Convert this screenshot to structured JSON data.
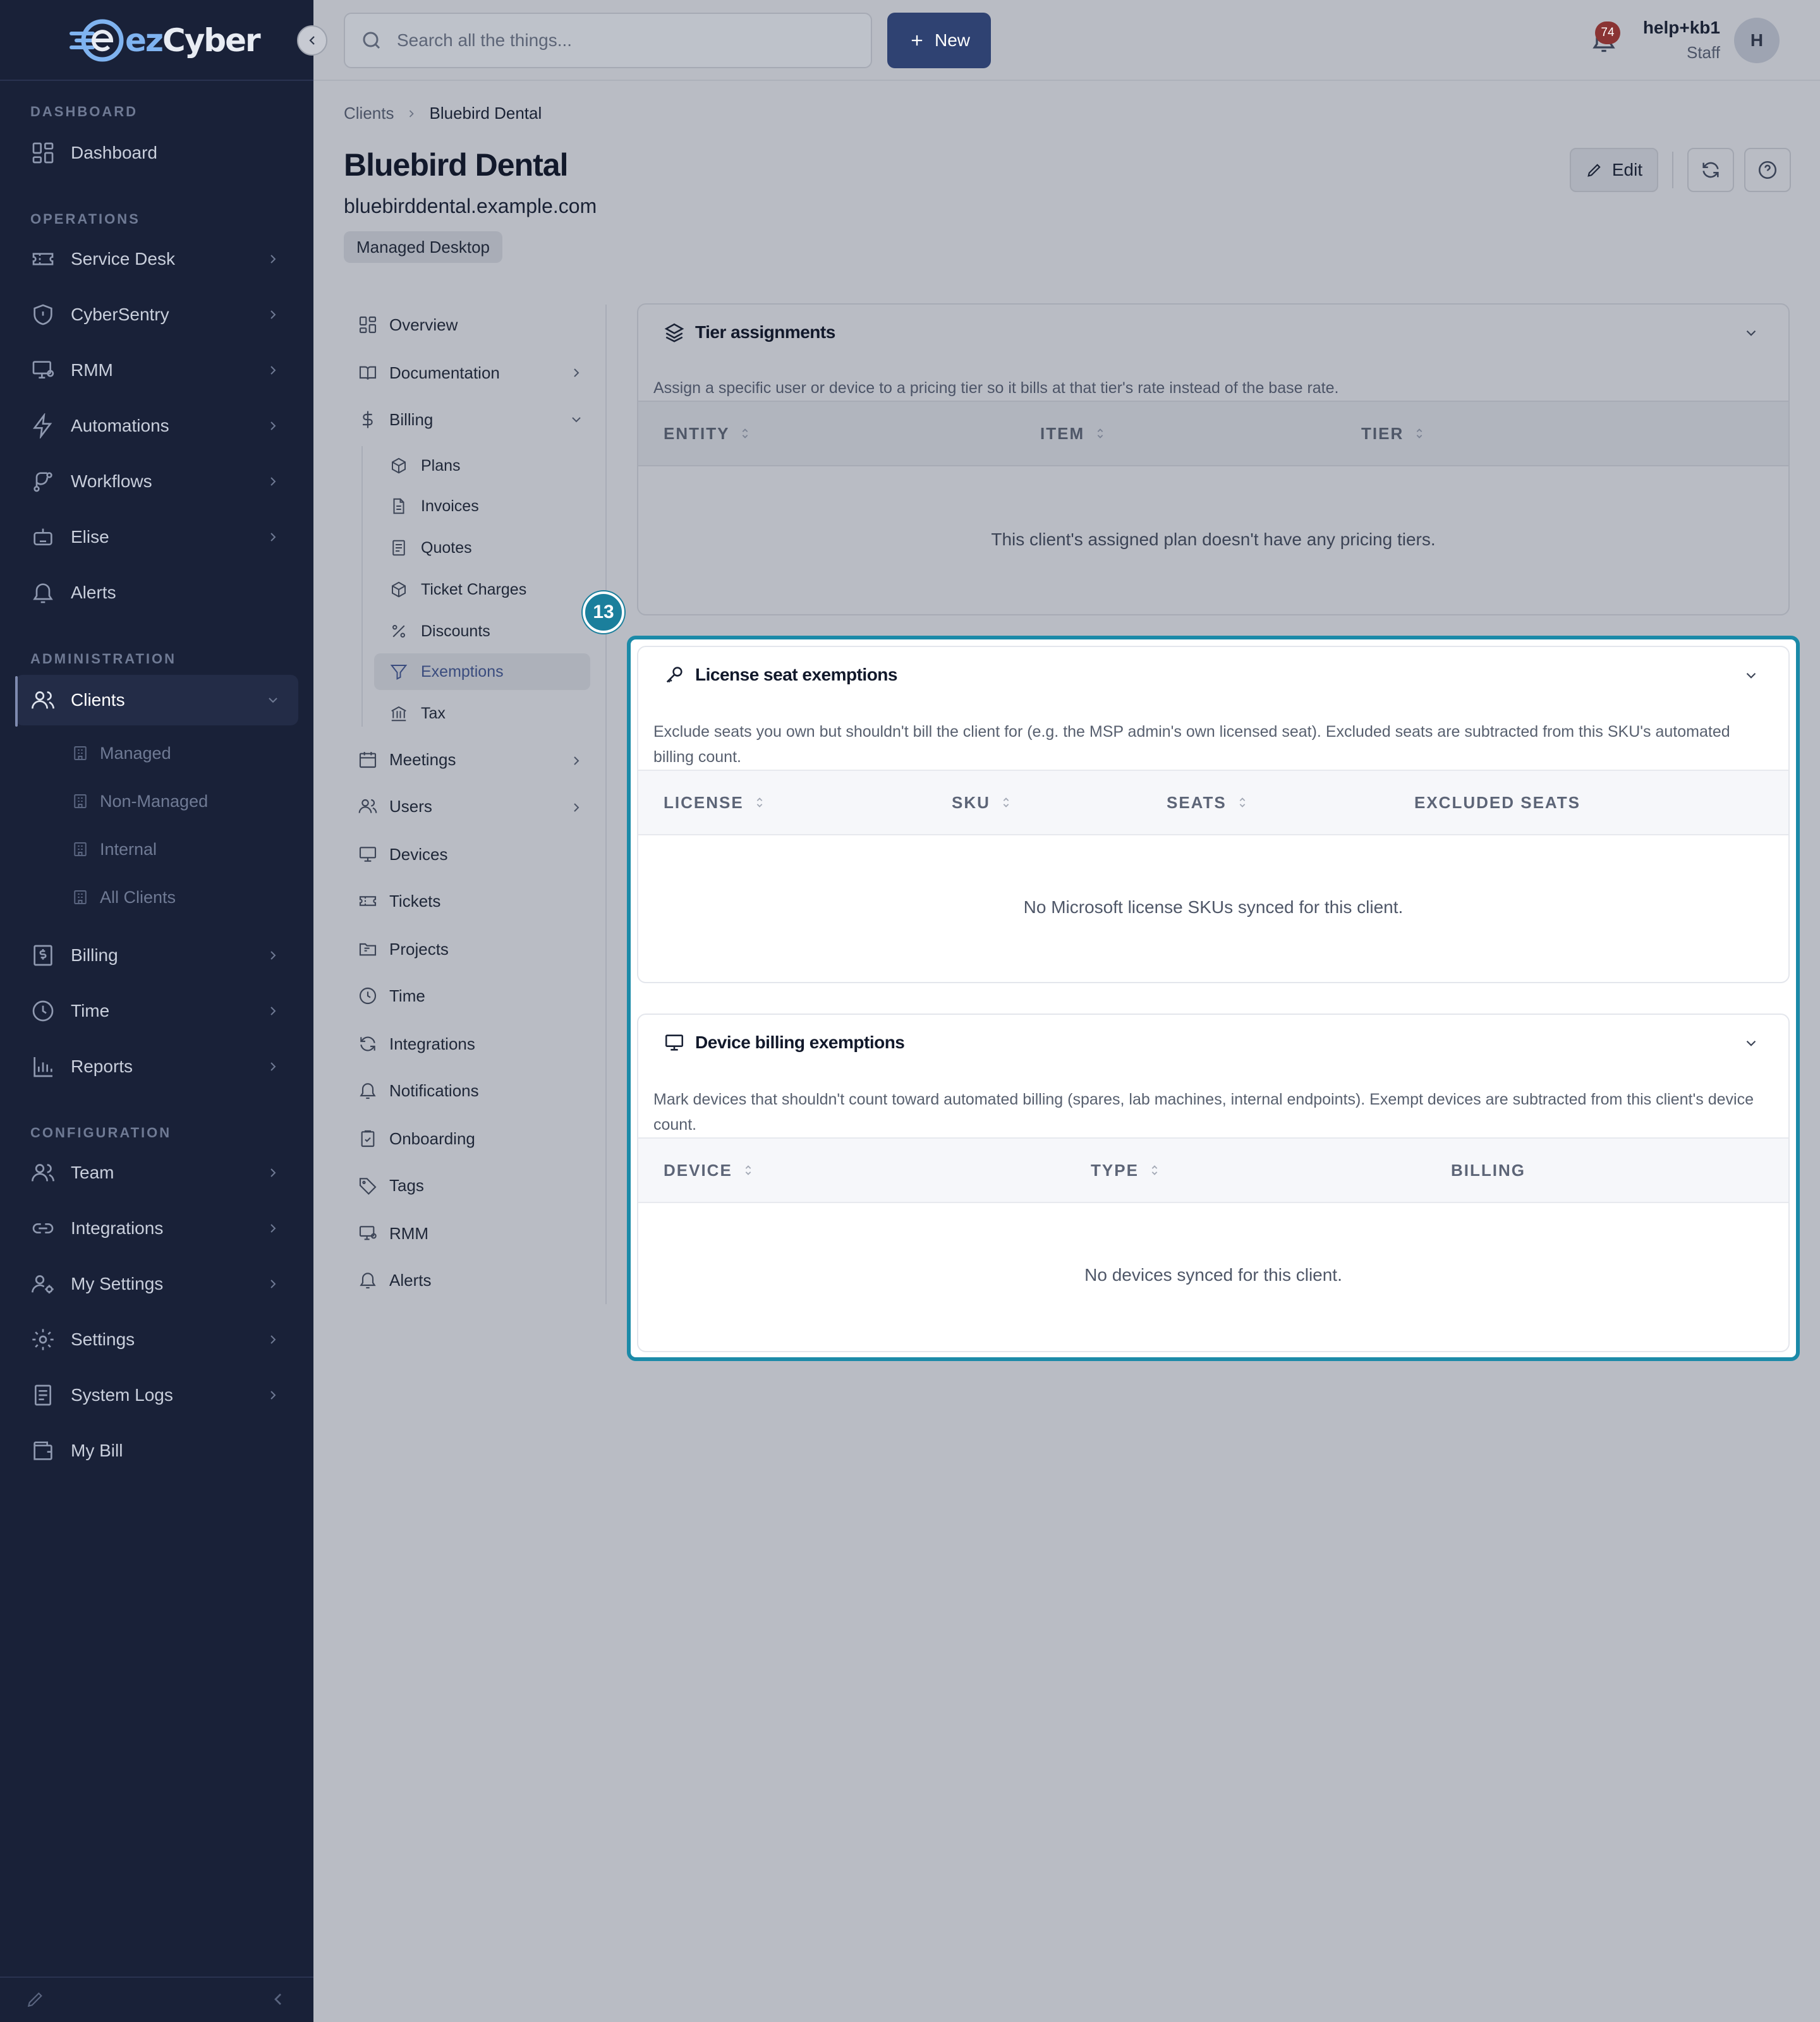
{
  "app": {
    "name": "ezCyber",
    "name_prefix": "ez",
    "name_suffix": "Cyber"
  },
  "sidebar": {
    "sections": {
      "dashboard": "DASHBOARD",
      "operations": "OPERATIONS",
      "administration": "ADMINISTRATION",
      "configuration": "CONFIGURATION"
    },
    "items": {
      "dashboard": "Dashboard",
      "service_desk": "Service Desk",
      "cybersentry": "CyberSentry",
      "rmm": "RMM",
      "automations": "Automations",
      "workflows": "Workflows",
      "elise": "Elise",
      "alerts": "Alerts",
      "clients": "Clients",
      "billing": "Billing",
      "time": "Time",
      "reports": "Reports",
      "team": "Team",
      "integrations": "Integrations",
      "my_settings": "My Settings",
      "settings": "Settings",
      "system_logs": "System Logs",
      "my_bill": "My Bill"
    },
    "clients_sub": {
      "managed": "Managed",
      "non_managed": "Non-Managed",
      "internal": "Internal",
      "all_clients": "All Clients"
    }
  },
  "topbar": {
    "search_placeholder": "Search all the things...",
    "new_label": "New",
    "notification_count": "74",
    "user_name": "help+kb1",
    "user_role": "Staff",
    "avatar_initial": "H"
  },
  "page": {
    "breadcrumb_root": "Clients",
    "breadcrumb_current": "Bluebird Dental",
    "title": "Bluebird Dental",
    "domain": "bluebirddental.example.com",
    "tag": "Managed Desktop",
    "edit_label": "Edit"
  },
  "subnav": {
    "overview": "Overview",
    "documentation": "Documentation",
    "billing": "Billing",
    "billing_sub": {
      "plans": "Plans",
      "invoices": "Invoices",
      "quotes": "Quotes",
      "ticket_charges": "Ticket Charges",
      "discounts": "Discounts",
      "exemptions": "Exemptions",
      "tax": "Tax"
    },
    "meetings": "Meetings",
    "users": "Users",
    "devices": "Devices",
    "tickets": "Tickets",
    "projects": "Projects",
    "time": "Time",
    "integrations": "Integrations",
    "notifications": "Notifications",
    "onboarding": "Onboarding",
    "tags": "Tags",
    "rmm": "RMM",
    "alerts": "Alerts"
  },
  "tier_card": {
    "title": "Tier assignments",
    "description": "Assign a specific user or device to a pricing tier so it bills at that tier's rate instead of the base rate.",
    "columns": [
      "ENTITY",
      "ITEM",
      "TIER"
    ],
    "empty": "This client's assigned plan doesn't have any pricing tiers."
  },
  "license_card": {
    "title": "License seat exemptions",
    "description": "Exclude seats you own but shouldn't bill the client for (e.g. the MSP admin's own licensed seat). Excluded seats are subtracted from this SKU's automated billing count.",
    "columns": [
      "LICENSE",
      "SKU",
      "SEATS",
      "EXCLUDED SEATS"
    ],
    "empty": "No Microsoft license SKUs synced for this client."
  },
  "device_card": {
    "title": "Device billing exemptions",
    "description": "Mark devices that shouldn't count toward automated billing (spares, lab machines, internal endpoints). Exempt devices are subtracted from this client's device count.",
    "columns": [
      "DEVICE",
      "TYPE",
      "BILLING"
    ],
    "empty": "No devices synced for this client."
  },
  "step_badge": "13",
  "colors": {
    "sidebar_bg": "#192138",
    "primary": "#2f4272",
    "highlight": "#1b8aa8",
    "badge": "#8a3434"
  }
}
